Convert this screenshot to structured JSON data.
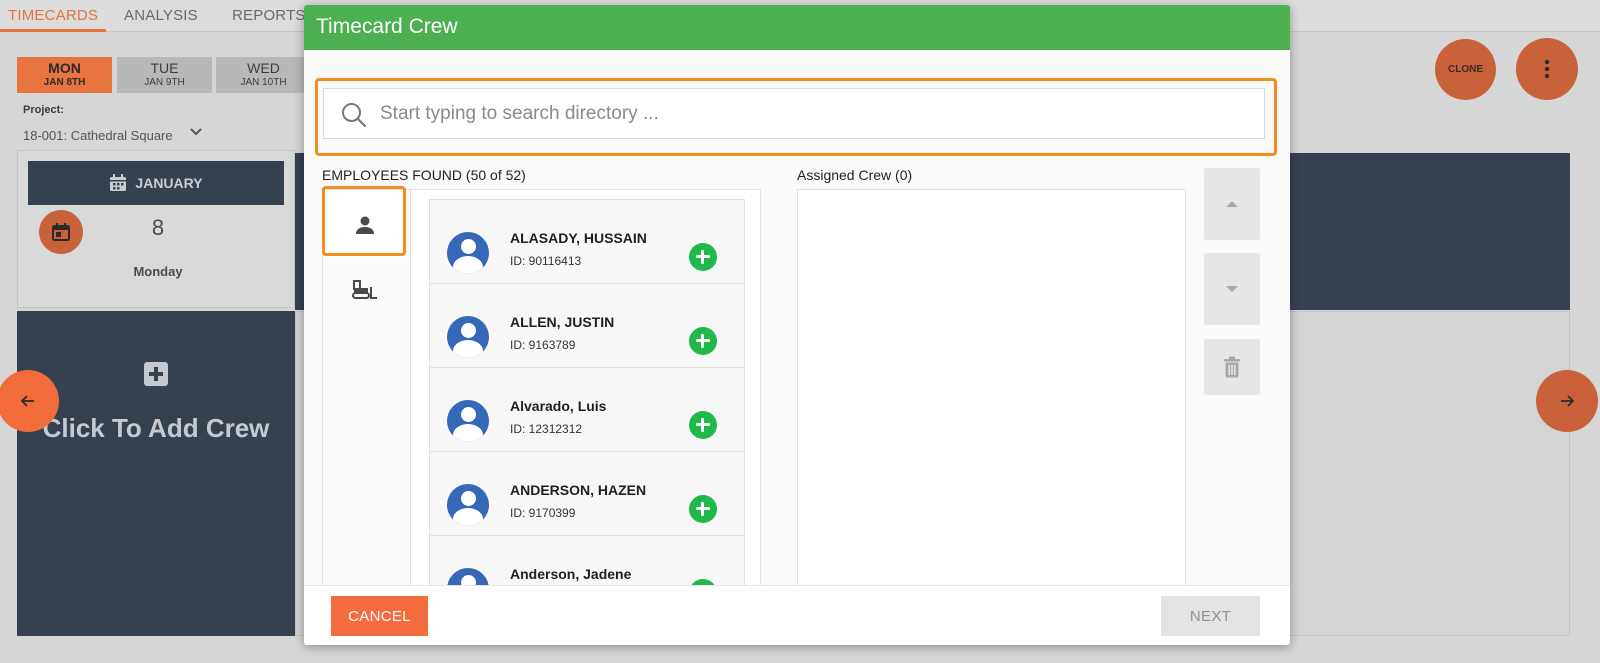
{
  "nav": {
    "tabs": [
      {
        "label": "TIMECARDS",
        "active": true
      },
      {
        "label": "ANALYSIS",
        "active": false
      },
      {
        "label": "REPORTS",
        "active": false
      }
    ]
  },
  "days": [
    {
      "day": "MON",
      "date": "JAN 8TH",
      "active": true
    },
    {
      "day": "TUE",
      "date": "JAN 9TH",
      "active": false
    },
    {
      "day": "WED",
      "date": "JAN 10TH",
      "active": false
    }
  ],
  "project": {
    "label": "Project:",
    "value": "18-001: Cathedral Square"
  },
  "calendar": {
    "month": "JANUARY",
    "day_number": "8",
    "weekday": "Monday"
  },
  "add_crew": {
    "label": "Click To Add Crew"
  },
  "actions": {
    "clone_label": "CLONE"
  },
  "modal": {
    "title": "Timecard Crew",
    "search": {
      "placeholder": "Start typing to search directory ...",
      "value": ""
    },
    "employees_found_label": "EMPLOYEES FOUND (50 of 52)",
    "assigned_crew_label": "Assigned Crew (0)",
    "employees": [
      {
        "name": "ALASADY, HUSSAIN",
        "id": "ID: 90116413"
      },
      {
        "name": "ALLEN, JUSTIN",
        "id": "ID: 9163789"
      },
      {
        "name": "Alvarado, Luis",
        "id": "ID: 12312312"
      },
      {
        "name": "ANDERSON, HAZEN",
        "id": "ID: 9170399"
      },
      {
        "name": "Anderson, Jadene",
        "id": ""
      }
    ],
    "cancel_label": "CANCEL",
    "next_label": "NEXT"
  },
  "colors": {
    "accent": "#e8743f",
    "header_green": "#4caf50",
    "add_green": "#1fb84a",
    "highlight": "#f68b1f"
  }
}
